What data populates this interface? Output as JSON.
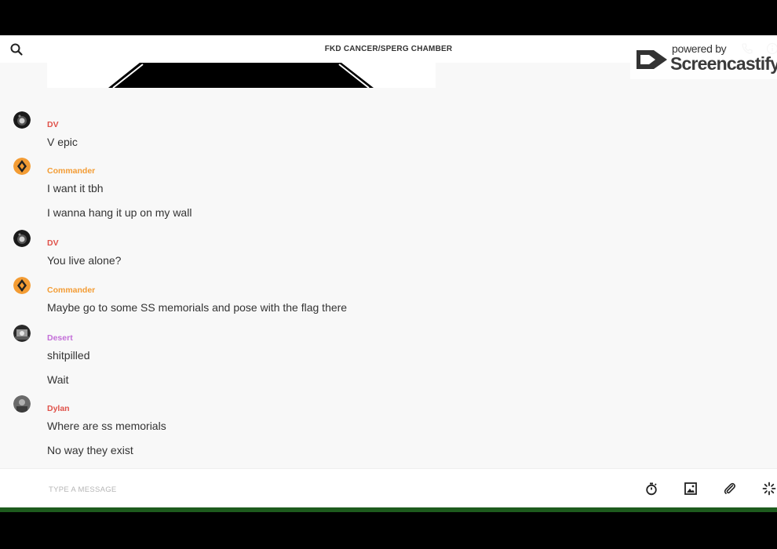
{
  "header": {
    "title": "FKD CANCER/SPERG CHAMBER"
  },
  "watermark": {
    "powered_by": "powered by",
    "brand": "Screencastify"
  },
  "messages": [
    {
      "author": "DV",
      "author_color": "#e0524a",
      "avatar": "dark-sphere",
      "texts": [
        "V epic"
      ]
    },
    {
      "author": "Commander",
      "author_color": "#f39c34",
      "avatar": "orange-diamond",
      "texts": [
        "I want it tbh",
        "I wanna hang it up on my wall"
      ]
    },
    {
      "author": "DV",
      "author_color": "#e0524a",
      "avatar": "dark-sphere",
      "texts": [
        "You live alone?"
      ]
    },
    {
      "author": "Commander",
      "author_color": "#f39c34",
      "avatar": "orange-diamond",
      "texts": [
        "Maybe go to some SS memorials and pose with the flag there"
      ]
    },
    {
      "author": "Desert",
      "author_color": "#c36ed8",
      "avatar": "bw-photo",
      "texts": [
        "shitpilled",
        "Wait"
      ]
    },
    {
      "author": "Dylan",
      "author_color": "#e0524a",
      "avatar": "grey-photo",
      "texts": [
        "Where are ss memorials",
        "No way they exist"
      ]
    }
  ],
  "composer": {
    "placeholder": "TYPE A MESSAGE",
    "value": "",
    "actions": [
      "timer-icon",
      "image-icon",
      "attachment-icon",
      "sparkle-icon"
    ]
  },
  "colors": {
    "background": "#f8f8f8",
    "dv": "#e0524a",
    "commander": "#f39c34",
    "desert": "#c36ed8",
    "bottom_bar": "#1d5b1d"
  }
}
